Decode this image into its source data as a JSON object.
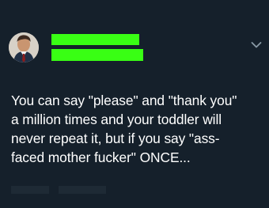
{
  "tweet": {
    "author": {
      "avatar_icon": "profile-photo",
      "name_redaction_color": "#39ff14",
      "handle_redaction_color": "#39ff14"
    },
    "menu_icon": "chevron-down-icon",
    "text": "You can say \"please\" and \"thank you\"\na million times and your toddler will\nnever repeat it, but if you say \"ass-\nfaced mother fucker\" ONCE..."
  },
  "colors": {
    "background": "#15202b",
    "text": "#ffffff",
    "muted": "#8899a6"
  }
}
